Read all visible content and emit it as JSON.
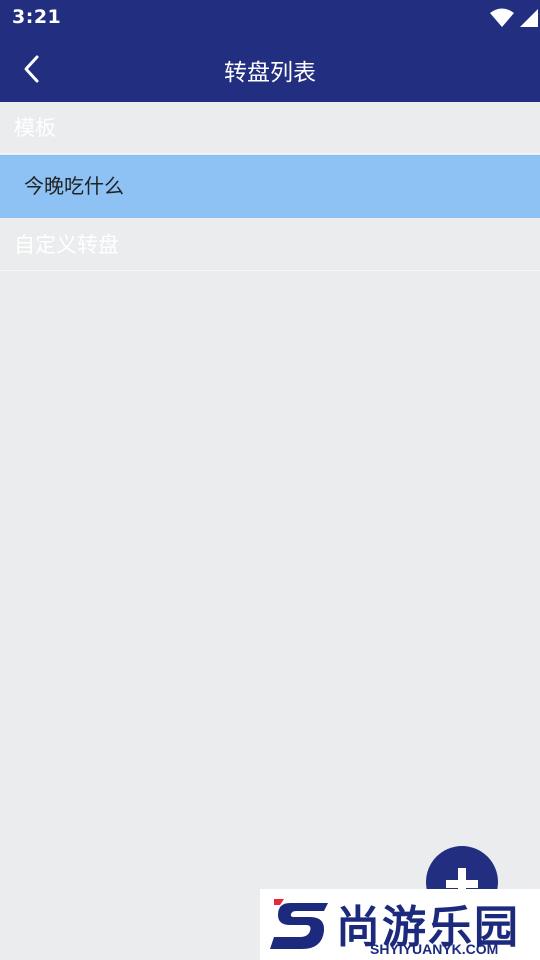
{
  "status_bar": {
    "time": "3:21",
    "icons": [
      "wifi-icon",
      "cell-signal-icon",
      "battery-charging-icon"
    ]
  },
  "app_bar": {
    "back_icon": "chevron-left-icon",
    "title": "转盘列表"
  },
  "sections": [
    {
      "header": "模板",
      "items": [
        {
          "label": "今晚吃什么"
        }
      ]
    },
    {
      "header": "自定义转盘",
      "items": []
    }
  ],
  "fab": {
    "icon": "plus-icon"
  },
  "colors": {
    "primary": "#222e80",
    "selected_item": "#8ec2f5",
    "background": "#ebecee"
  },
  "watermark": {
    "text": "尚游乐园",
    "url": "SHYIYUANYK.COM"
  }
}
